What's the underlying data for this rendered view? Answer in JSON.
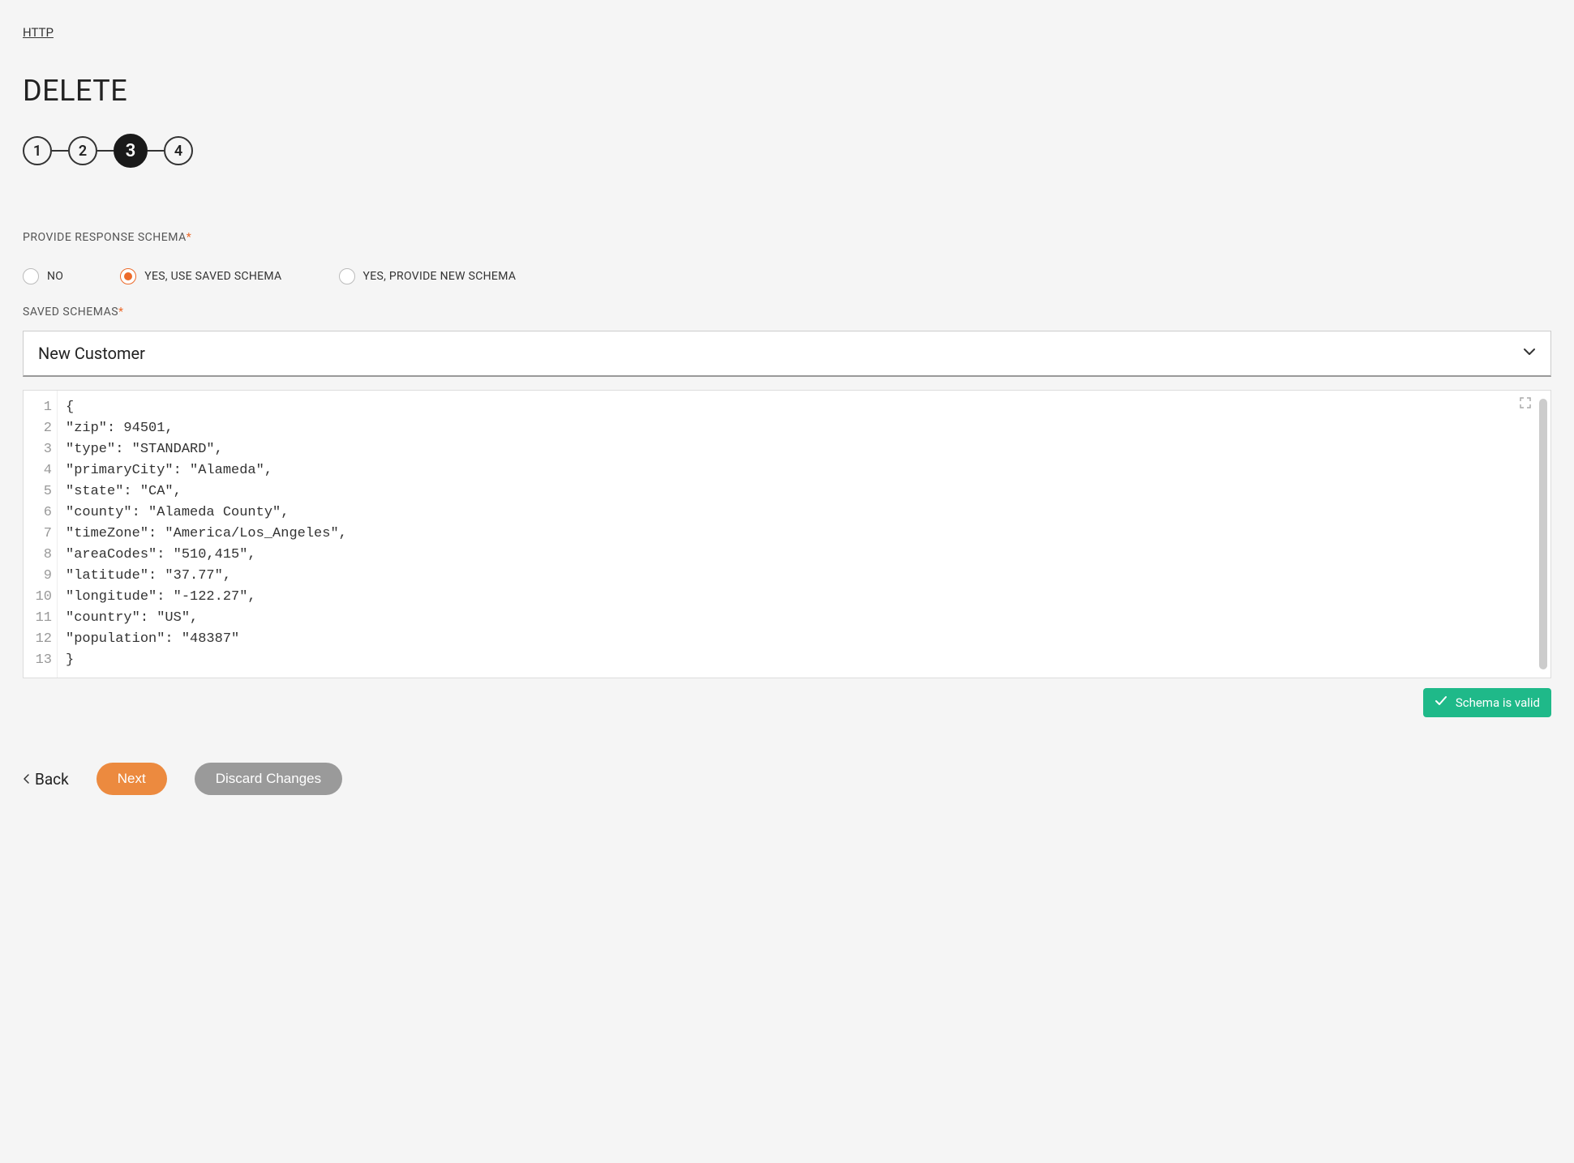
{
  "breadcrumb": {
    "label": "HTTP"
  },
  "title": "DELETE",
  "stepper": {
    "steps": [
      "1",
      "2",
      "3",
      "4"
    ],
    "active_index": 2
  },
  "response_schema": {
    "label": "PROVIDE RESPONSE SCHEMA",
    "options": {
      "no": "NO",
      "use_saved": "YES, USE SAVED SCHEMA",
      "provide_new": "YES, PROVIDE NEW SCHEMA"
    },
    "selected": "use_saved"
  },
  "saved_schemas": {
    "label": "SAVED SCHEMAS",
    "selected": "New Customer"
  },
  "editor": {
    "lines": [
      "{",
      "\"zip\": 94501,",
      "\"type\": \"STANDARD\",",
      "\"primaryCity\": \"Alameda\",",
      "\"state\": \"CA\",",
      "\"county\": \"Alameda County\",",
      "\"timeZone\": \"America/Los_Angeles\",",
      "\"areaCodes\": \"510,415\",",
      "\"latitude\": \"37.77\",",
      "\"longitude\": \"-122.27\",",
      "\"country\": \"US\",",
      "\"population\": \"48387\"",
      "}"
    ]
  },
  "validation": {
    "message": "Schema is valid"
  },
  "actions": {
    "back": "Back",
    "next": "Next",
    "discard": "Discard Changes"
  }
}
